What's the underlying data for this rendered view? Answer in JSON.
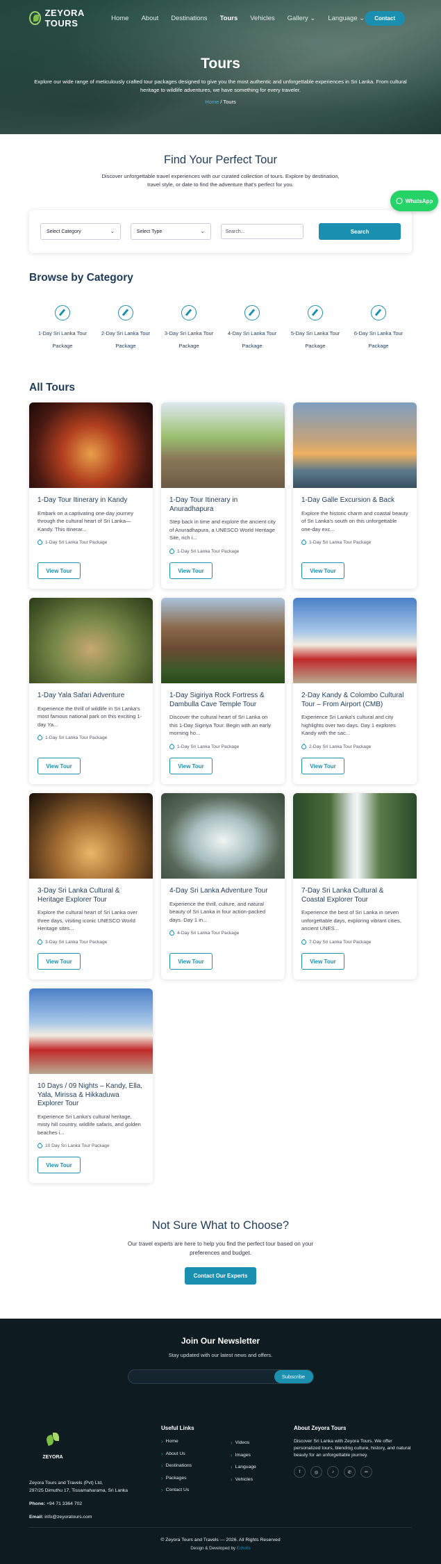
{
  "nav": {
    "brand": "ZEYORA TOURS",
    "items": [
      {
        "label": "Home"
      },
      {
        "label": "About"
      },
      {
        "label": "Destinations"
      },
      {
        "label": "Tours"
      },
      {
        "label": "Vehicles"
      },
      {
        "label": "Gallery ⌄"
      },
      {
        "label": "Language ⌄"
      }
    ],
    "contact": "Contact"
  },
  "hero": {
    "title": "Tours",
    "subtitle": "Explore our wide range of meticulously crafted tour packages designed to give you the most authentic and unforgettable experiences in Sri Lanka. From cultural heritage to wildlife adventures, we have something for every traveler.",
    "crumb_home": "Home",
    "crumb_sep": "/",
    "crumb_current": "Tours"
  },
  "whatsapp": "WhatsApp",
  "find": {
    "title": "Find Your Perfect Tour",
    "text1": "Discover unforgettable travel experiences with our curated collection of tours. Explore by destination,",
    "text2": "travel style, or date to find the adventure that's perfect for you."
  },
  "filter": {
    "category": "Select Category",
    "type": "Select Type",
    "search_placeholder": "Search...",
    "button": "Search"
  },
  "categories": {
    "title": "Browse by Category",
    "items": [
      {
        "label": "1-Day Sri Lanka Tour Package"
      },
      {
        "label": "2-Day Sri Lanka Tour Package"
      },
      {
        "label": "3-Day Sri Lanka Tour Package"
      },
      {
        "label": "4-Day Sri Lanka Tour Package"
      },
      {
        "label": "5-Day Sri Lanka Tour Package"
      },
      {
        "label": "6-Day Sri Lanka Tour Package"
      }
    ]
  },
  "tours": {
    "title": "All Tours",
    "button": "View Tour",
    "items": [
      {
        "title": "1-Day Tour Itinerary in Kandy",
        "desc": "Embark on a captivating one-day journey through the cultural heart of Sri Lanka—Kandy. This itinerar...",
        "tag": "1-Day Sri Lanka Tour Package"
      },
      {
        "title": "1-Day Tour Itinerary in Anuradhapura",
        "desc": "Step back in time and explore the ancient city of Anuradhapura, a UNESCO World Heritage Site, rich i...",
        "tag": "1-Day Sri Lanka Tour Package"
      },
      {
        "title": "1-Day Galle Excursion & Back",
        "desc": "Explore the historic charm and coastal beauty of Sri Lanka's south on this unforgettable one-day exc...",
        "tag": "1-Day Sri Lanka Tour Package"
      },
      {
        "title": "1-Day Yala Safari Adventure",
        "desc": "Experience the thrill of wildlife in Sri Lanka's most famous national park on this exciting 1-day Ya...",
        "tag": "1-Day Sri Lanka Tour Package"
      },
      {
        "title": "1-Day Sigiriya Rock Fortress & Dambulla Cave Temple Tour",
        "desc": "Discover the cultural heart of Sri Lanka on this 1-Day Sigiriya Tour. Begin with an early morning ho...",
        "tag": "1-Day Sri Lanka Tour Package"
      },
      {
        "title": "2-Day Kandy & Colombo Cultural Tour – From Airport (CMB)",
        "desc": "Experience Sri Lanka's cultural and city highlights over two days. Day 1 explores Kandy with the sac...",
        "tag": "2-Day Sri Lanka Tour Package"
      },
      {
        "title": "3-Day Sri Lanka Cultural & Heritage Explorer Tour",
        "desc": "Explore the cultural heart of Sri Lanka over three days, visiting iconic UNESCO World Heritage sites...",
        "tag": "3-Day Sri Lanka Tour Package"
      },
      {
        "title": "4-Day Sri Lanka Adventure Tour",
        "desc": "Experience the thrill, culture, and natural beauty of Sri Lanka in four action-packed days. Day 1 in...",
        "tag": "4-Day Sri Lanka Tour Package"
      },
      {
        "title": "7-Day Sri Lanka Cultural & Coastal Explorer Tour",
        "desc": "Experience the best of Sri Lanka in seven unforgettable days, exploring vibrant cities, ancient UNES...",
        "tag": "7-Day Sri Lanka Tour Package"
      },
      {
        "title": "10 Days / 09 Nights – Kandy, Ella, Yala, Mirissa & Hikkaduwa Explorer Tour",
        "desc": "Experience Sri Lanka's cultural heritage, misty hill country, wildlife safaris, and golden beaches i...",
        "tag": "10 Day Sri Lanka Tour Package"
      }
    ]
  },
  "cta": {
    "title": "Not Sure What to Choose?",
    "text1": "Our travel experts are here to help you find the perfect tour based on your",
    "text2": "preferences and budget.",
    "button": "Contact Our Experts"
  },
  "newsletter": {
    "title": "Join Our Newsletter",
    "text": "Stay updated with our latest news and offers.",
    "button": "Subscribe"
  },
  "footer": {
    "logo_text": "ZEYORA",
    "company": "Zeyora Tours and Travels (Pvt) Ltd,",
    "address": "297/25 Dimuthu 17, Tissamaharama, Sri Lanka",
    "phone_label": "Phone:",
    "phone": "+94 71 3364 702",
    "email_label": "Email:",
    "email": "info@zeyoratours.com",
    "useful_title": "Useful Links",
    "links_col1": [
      {
        "label": "Home"
      },
      {
        "label": "About Us"
      },
      {
        "label": "Destinations"
      },
      {
        "label": "Packages"
      },
      {
        "label": "Contact Us"
      }
    ],
    "links_col2": [
      {
        "label": "Videos"
      },
      {
        "label": "Images"
      },
      {
        "label": "Language"
      },
      {
        "label": "Vehicles"
      }
    ],
    "about_title": "About Zeyora Tours",
    "about_text": "Discover Sri Lanka with Zeyora Tours. We offer personalized tours, blending culture, history, and natural beauty for an unforgettable journey.",
    "copyright": "© Zeyora Tours and Travels — 2026. All Rights Reserved",
    "designed_by": "Design & Developed by",
    "designer": "Echolis"
  }
}
